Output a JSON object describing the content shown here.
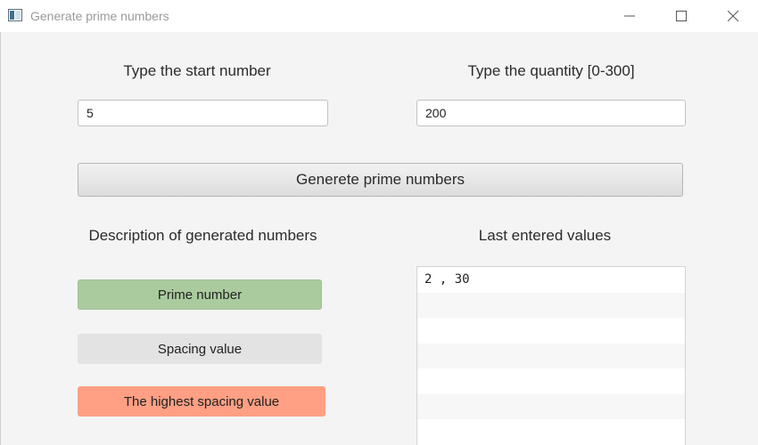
{
  "window": {
    "title": "Generate prime numbers",
    "icon": "app-window-icon",
    "controls": [
      "minimize-icon",
      "maximize-icon",
      "close-icon"
    ]
  },
  "form": {
    "start_label": "Type the start number",
    "start_value": "5",
    "quantity_label": "Type the quantity [0-300]",
    "quantity_value": "200",
    "generate_button": "Generete prime numbers"
  },
  "legend": {
    "title": "Description of generated numbers",
    "items": [
      {
        "label": "Prime number",
        "color": "#aacb9e"
      },
      {
        "label": "Spacing value",
        "color": "#e3e3e3"
      },
      {
        "label": "The highest spacing value",
        "color": "#ff9f84"
      }
    ]
  },
  "history": {
    "title": "Last entered values",
    "rows": [
      "2 , 30",
      "",
      "",
      "",
      "",
      ""
    ]
  }
}
